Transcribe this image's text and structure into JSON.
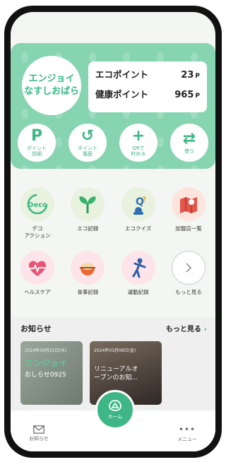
{
  "header": {
    "logo_line1": "エンジョイ",
    "logo_line2": "なすしおばら",
    "eco_label": "エコポイント",
    "eco_value": "23",
    "health_label": "健康ポイント",
    "health_value": "965",
    "unit": "P"
  },
  "quick_actions": [
    {
      "glyph": "P",
      "label": "ポイント\n詳細"
    },
    {
      "glyph": "↺",
      "label": "ポイント\n履歴"
    },
    {
      "glyph": "+",
      "label": "QRで\n貯める"
    },
    {
      "glyph": "⇄",
      "label": "使う"
    }
  ],
  "features_row1": [
    {
      "icon": "deco-icon",
      "label": "デコ\nアクション",
      "icon_text": "Deco"
    },
    {
      "icon": "sprout-icon",
      "label": "エコ記録"
    },
    {
      "icon": "quiz-icon",
      "label": "エコクイズ"
    },
    {
      "icon": "map-icon",
      "label": "加盟店一覧"
    }
  ],
  "features_row2": [
    {
      "icon": "heart-icon",
      "label": "ヘルスケア"
    },
    {
      "icon": "meal-icon",
      "label": "食事記録"
    },
    {
      "icon": "exercise-icon",
      "label": "運動記録"
    },
    {
      "icon": "chevron-right-icon",
      "label": "もっと見る"
    }
  ],
  "news": {
    "title": "お知らせ",
    "more": "もっと見る",
    "cards": [
      {
        "date": "2024年09月25日(水)",
        "title": "おしらせ0925",
        "bg_text": "エンジョイ"
      },
      {
        "date": "2024年03月08日(金)",
        "title": "リニューアルオ\nープンのお知..."
      }
    ]
  },
  "bottom_nav": {
    "left": "お知らせ",
    "home": "ホーム",
    "right": "メニュー"
  },
  "colors": {
    "brand": "#3fb685",
    "header_bg": "#86d4b0"
  }
}
